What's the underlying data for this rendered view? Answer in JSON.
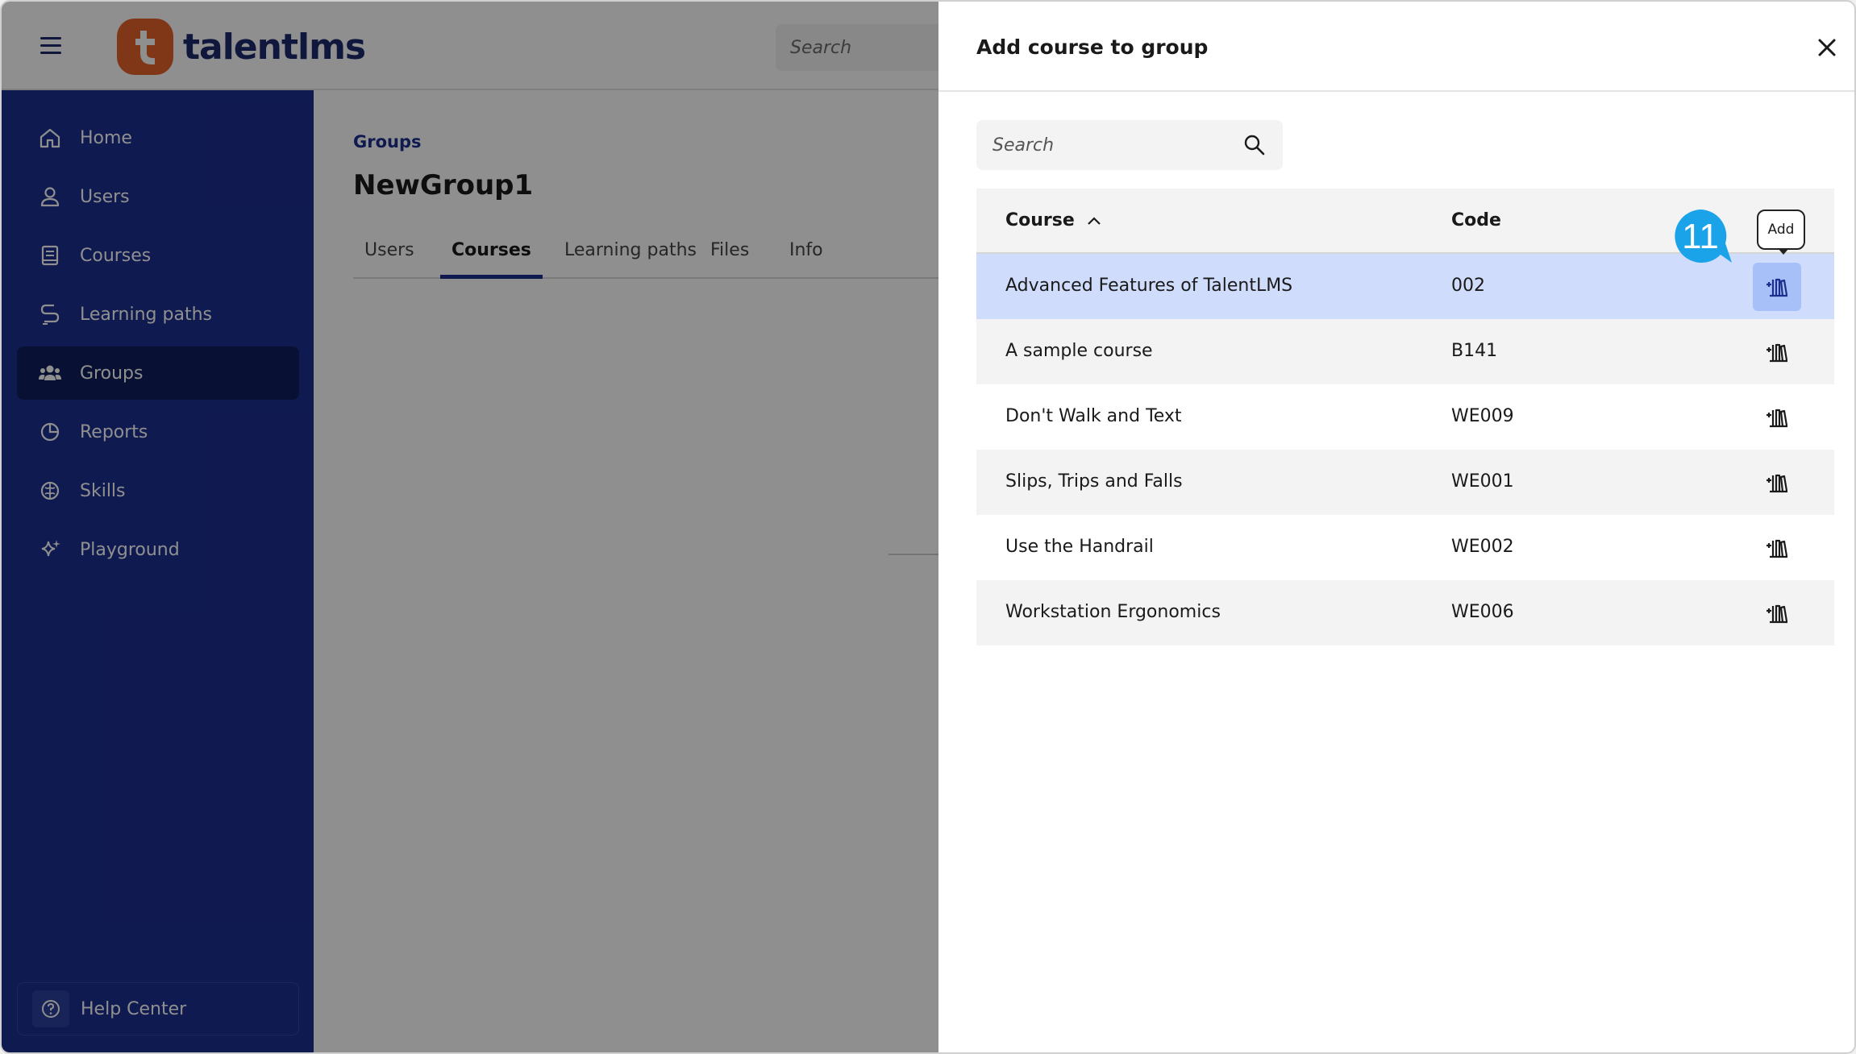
{
  "app": {
    "logo_text": "talentlms",
    "top_search_placeholder": "Search"
  },
  "sidebar": {
    "items": [
      {
        "label": "Home",
        "icon": "home-icon"
      },
      {
        "label": "Users",
        "icon": "user-icon"
      },
      {
        "label": "Courses",
        "icon": "book-icon"
      },
      {
        "label": "Learning paths",
        "icon": "path-icon"
      },
      {
        "label": "Groups",
        "icon": "group-icon",
        "active": true
      },
      {
        "label": "Reports",
        "icon": "pie-chart-icon"
      },
      {
        "label": "Skills",
        "icon": "brain-icon"
      },
      {
        "label": "Playground",
        "icon": "sparkle-icon"
      }
    ],
    "help_label": "Help Center"
  },
  "main": {
    "breadcrumb": "Groups",
    "title": "NewGroup1",
    "tabs": [
      "Users",
      "Courses",
      "Learning paths",
      "Files",
      "Info"
    ],
    "active_tab": "Courses"
  },
  "drawer": {
    "title": "Add course to group",
    "search_placeholder": "Search",
    "columns": {
      "course": "Course",
      "code": "Code"
    },
    "rows": [
      {
        "course": "Advanced Features of TalentLMS",
        "code": "002"
      },
      {
        "course": "A sample course",
        "code": "B141"
      },
      {
        "course": "Don't Walk and Text",
        "code": "WE009"
      },
      {
        "course": "Slips, Trips and Falls",
        "code": "WE001"
      },
      {
        "course": "Use the Handrail",
        "code": "WE002"
      },
      {
        "course": "Workstation Ergonomics",
        "code": "WE006"
      }
    ],
    "tooltip": "Add",
    "step_number": "11"
  },
  "colors": {
    "brand_navy": "#1c2f8f",
    "logo_orange": "#e3632b",
    "highlight_row": "#cfdcfb",
    "step_badge": "#1aa3e8"
  }
}
